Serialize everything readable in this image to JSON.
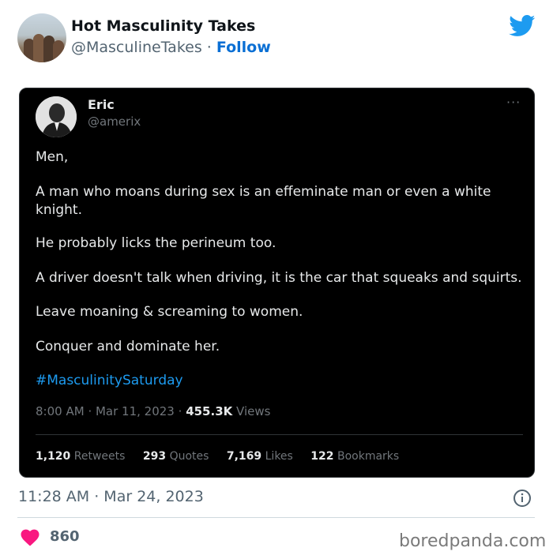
{
  "header": {
    "name": "Hot Masculinity Takes",
    "handle": "@MasculineTakes",
    "separator": "·",
    "follow_label": "Follow"
  },
  "embedded_tweet": {
    "author_name": "Eric",
    "author_handle": "@amerix",
    "more_icon": "···",
    "paragraphs": [
      "Men,",
      "A man who moans during sex is an effeminate man or even a white knight.",
      "He probably licks the perineum too.",
      "A driver doesn't talk when driving, it is the car that squeaks and squirts.",
      "Leave moaning & screaming to women.",
      "Conquer and dominate her."
    ],
    "hashtag": "#MasculinitySaturday",
    "time": "8:00 AM",
    "date": "Mar 11, 2023",
    "views_count": "455.3K",
    "views_label": "Views",
    "stats": [
      {
        "count": "1,120",
        "label": "Retweets"
      },
      {
        "count": "293",
        "label": "Quotes"
      },
      {
        "count": "7,169",
        "label": "Likes"
      },
      {
        "count": "122",
        "label": "Bookmarks"
      }
    ]
  },
  "footer": {
    "timestamp": "11:28 AM · Mar 24, 2023",
    "likes": "860",
    "watermark": "boredpanda.com"
  },
  "colors": {
    "follow_blue": "#0a6fd4",
    "twitter_blue": "#1d9bf0",
    "heart_pink": "#f91880",
    "card_bg": "#000000"
  },
  "icons": [
    "twitter-bird-icon",
    "more-options-icon",
    "info-icon",
    "heart-icon"
  ]
}
